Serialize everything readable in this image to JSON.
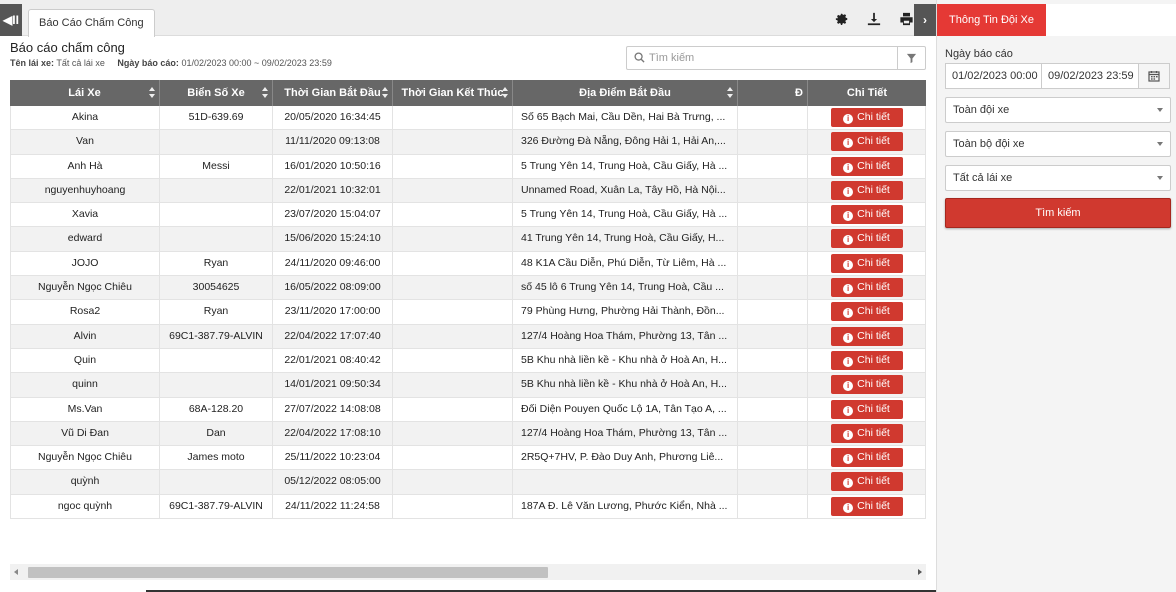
{
  "topbar": {
    "collapse_left": "◀II",
    "tab_label": "Báo Cáo Chấm Công",
    "collapse_right": "›"
  },
  "report": {
    "title": "Báo cáo chấm công",
    "driver_label": "Tên lái xe:",
    "driver_value": "Tất cả lái xe",
    "date_label": "Ngày báo cáo:",
    "date_value": "01/02/2023 00:00 ~ 09/02/2023 23:59"
  },
  "search": {
    "placeholder": "Tìm kiếm"
  },
  "table": {
    "headers": [
      "Lái Xe",
      "Biển Số Xe",
      "Thời Gian Bắt Đầu",
      "Thời Gian Kết Thúc",
      "Địa Điểm Bắt Đầu",
      "Đ",
      "Chi Tiết"
    ],
    "detail_label": "Chi tiết",
    "rows": [
      {
        "driver": "Akina",
        "plate": "51D-639.69",
        "start": "20/05/2020 16:34:45",
        "end": "",
        "place": "Số 65 Bạch Mai, Cầu Dền, Hai Bà Trưng, ..."
      },
      {
        "driver": "Van",
        "plate": "",
        "start": "11/11/2020 09:13:08",
        "end": "",
        "place": "326 Đường Đà Nẵng, Đông Hải 1, Hải An,..."
      },
      {
        "driver": "Anh Hà",
        "plate": "Messi",
        "start": "16/01/2020 10:50:16",
        "end": "",
        "place": "5 Trung Yên 14, Trung Hoà, Cầu Giấy, Hà ..."
      },
      {
        "driver": "nguyenhuyhoang",
        "plate": "",
        "start": "22/01/2021 10:32:01",
        "end": "",
        "place": "Unnamed Road, Xuân La, Tây Hồ, Hà Nội..."
      },
      {
        "driver": "Xavia",
        "plate": "",
        "start": "23/07/2020 15:04:07",
        "end": "",
        "place": "5 Trung Yên 14, Trung Hoà, Cầu Giấy, Hà ..."
      },
      {
        "driver": "edward",
        "plate": "",
        "start": "15/06/2020 15:24:10",
        "end": "",
        "place": "41 Trung Yên 14, Trung Hoà, Cầu Giấy, H..."
      },
      {
        "driver": "JOJO",
        "plate": "Ryan",
        "start": "24/11/2020 09:46:00",
        "end": "",
        "place": "48 K1A Cầu Diễn, Phú Diễn, Từ Liêm, Hà ..."
      },
      {
        "driver": "Nguyễn Ngọc Chiêu",
        "plate": "30054625",
        "start": "16/05/2022 08:09:00",
        "end": "",
        "place": "số 45 lô 6 Trung Yên 14, Trung Hoà, Cầu ..."
      },
      {
        "driver": "Rosa2",
        "plate": "Ryan",
        "start": "23/11/2020 17:00:00",
        "end": "",
        "place": "79 Phùng Hưng, Phường Hải Thành, Đồn..."
      },
      {
        "driver": "Alvin",
        "plate": "69C1-387.79-ALVIN",
        "start": "22/04/2022 17:07:40",
        "end": "",
        "place": "127/4 Hoàng Hoa Thám, Phường 13, Tân ..."
      },
      {
        "driver": "Quin",
        "plate": "",
        "start": "22/01/2021 08:40:42",
        "end": "",
        "place": "5B Khu nhà liền kề - Khu nhà ở Hoà An, H..."
      },
      {
        "driver": "quinn",
        "plate": "",
        "start": "14/01/2021 09:50:34",
        "end": "",
        "place": "5B Khu nhà liền kề - Khu nhà ở Hoà An, H..."
      },
      {
        "driver": "Ms.Van",
        "plate": "68A-128.20",
        "start": "27/07/2022 14:08:08",
        "end": "",
        "place": "Đối Diện Pouyen Quốc Lộ 1A, Tân Tạo A, ..."
      },
      {
        "driver": "Vũ Di Đan",
        "plate": "Dan",
        "start": "22/04/2022 17:08:10",
        "end": "",
        "place": "127/4 Hoàng Hoa Thám, Phường 13, Tân ..."
      },
      {
        "driver": "Nguyễn Ngọc Chiêu",
        "plate": "James moto",
        "start": "25/11/2022 10:23:04",
        "end": "",
        "place": "2R5Q+7HV, P. Đào Duy Anh, Phương Liê..."
      },
      {
        "driver": "quỳnh",
        "plate": "",
        "start": "05/12/2022 08:05:00",
        "end": "",
        "place": ""
      },
      {
        "driver": "ngoc quỳnh",
        "plate": "69C1-387.79-ALVIN",
        "start": "24/11/2022 11:24:58",
        "end": "",
        "place": "187A Đ. Lê Văn Lương, Phước Kiển, Nhà ..."
      }
    ]
  },
  "panel": {
    "title": "Thông Tin Đội Xe",
    "date_label": "Ngày báo cáo",
    "date_from": "01/02/2023 00:00",
    "date_to": "09/02/2023 23:59",
    "fleet_select": "Toàn đội xe",
    "group_select": "Toàn bộ đội xe",
    "driver_select": "Tất cả lái xe",
    "search_button": "Tìm kiếm"
  },
  "colors": {
    "accent": "#d0392f",
    "header_bg": "#676767",
    "panel_head": "#e53935"
  }
}
